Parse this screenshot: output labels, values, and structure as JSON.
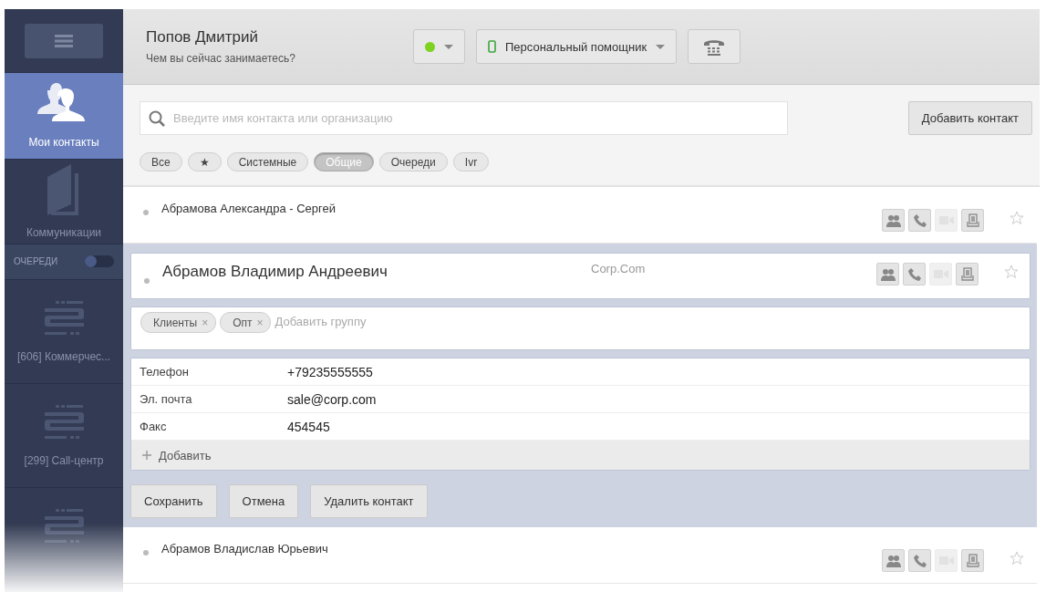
{
  "sidebar": {
    "nav": [
      {
        "kind": "contacts",
        "label": "Мои контакты",
        "selected": true
      },
      {
        "kind": "communications",
        "label": "Коммуникации",
        "selected": false
      }
    ],
    "queue_toggle": {
      "label": "ОЧЕРЕДИ",
      "on": false
    },
    "queues": [
      {
        "label": "[606] Коммерчес..."
      },
      {
        "label": "[299] Call-центр"
      },
      {
        "kind": "faded"
      }
    ]
  },
  "header": {
    "user_name": "Попов Дмитрий",
    "status_prompt": "Чем вы сейчас занимаетесь?",
    "online": true,
    "assistant": "Персональный помощник"
  },
  "search": {
    "placeholder": "Введите имя контакта или организацию"
  },
  "add_contact": "Добавить контакт",
  "filters": [
    {
      "label": "Все",
      "selected": false
    },
    {
      "label": "★",
      "selected": false
    },
    {
      "label": "Системные",
      "selected": false
    },
    {
      "label": "Общие",
      "selected": true
    },
    {
      "label": "Очереди",
      "selected": false
    },
    {
      "label": "Ivr",
      "selected": false
    }
  ],
  "contacts": [
    {
      "kind": "collapsed",
      "name": "Абрамова Александра - Сергей",
      "favorite": false,
      "actions": [
        {
          "kind": "conference",
          "disabled": false
        },
        {
          "kind": "call",
          "disabled": false
        },
        {
          "kind": "video",
          "disabled": true
        },
        {
          "kind": "fax",
          "disabled": false
        }
      ]
    },
    {
      "kind": "expanded",
      "name": "Абрамов Владимир Андреевич",
      "company": "Corp.Com",
      "favorite": false,
      "actions": [
        {
          "kind": "conference",
          "disabled": false
        },
        {
          "kind": "call",
          "disabled": false
        },
        {
          "kind": "video",
          "disabled": true
        },
        {
          "kind": "fax",
          "disabled": false
        }
      ],
      "groups": [
        {
          "label": "Клиенты",
          "remove": "×"
        },
        {
          "label": "Опт",
          "remove": "×"
        }
      ],
      "group_placeholder": "Добавить группу",
      "fields": [
        {
          "label": "Телефон",
          "value": "+79235555555"
        },
        {
          "label": "Эл. почта",
          "value": "sale@corp.com"
        },
        {
          "label": "Факс",
          "value": "454545"
        }
      ],
      "add_field": "Добавить",
      "buttons": [
        "Сохранить",
        "Отмена",
        "Удалить контакт"
      ]
    },
    {
      "kind": "collapsed",
      "name": "Абрамов Владислав Юрьевич",
      "favorite": false,
      "actions": [
        {
          "kind": "conference",
          "disabled": false
        },
        {
          "kind": "call",
          "disabled": false
        },
        {
          "kind": "video",
          "disabled": true
        },
        {
          "kind": "fax",
          "disabled": false
        }
      ]
    }
  ]
}
